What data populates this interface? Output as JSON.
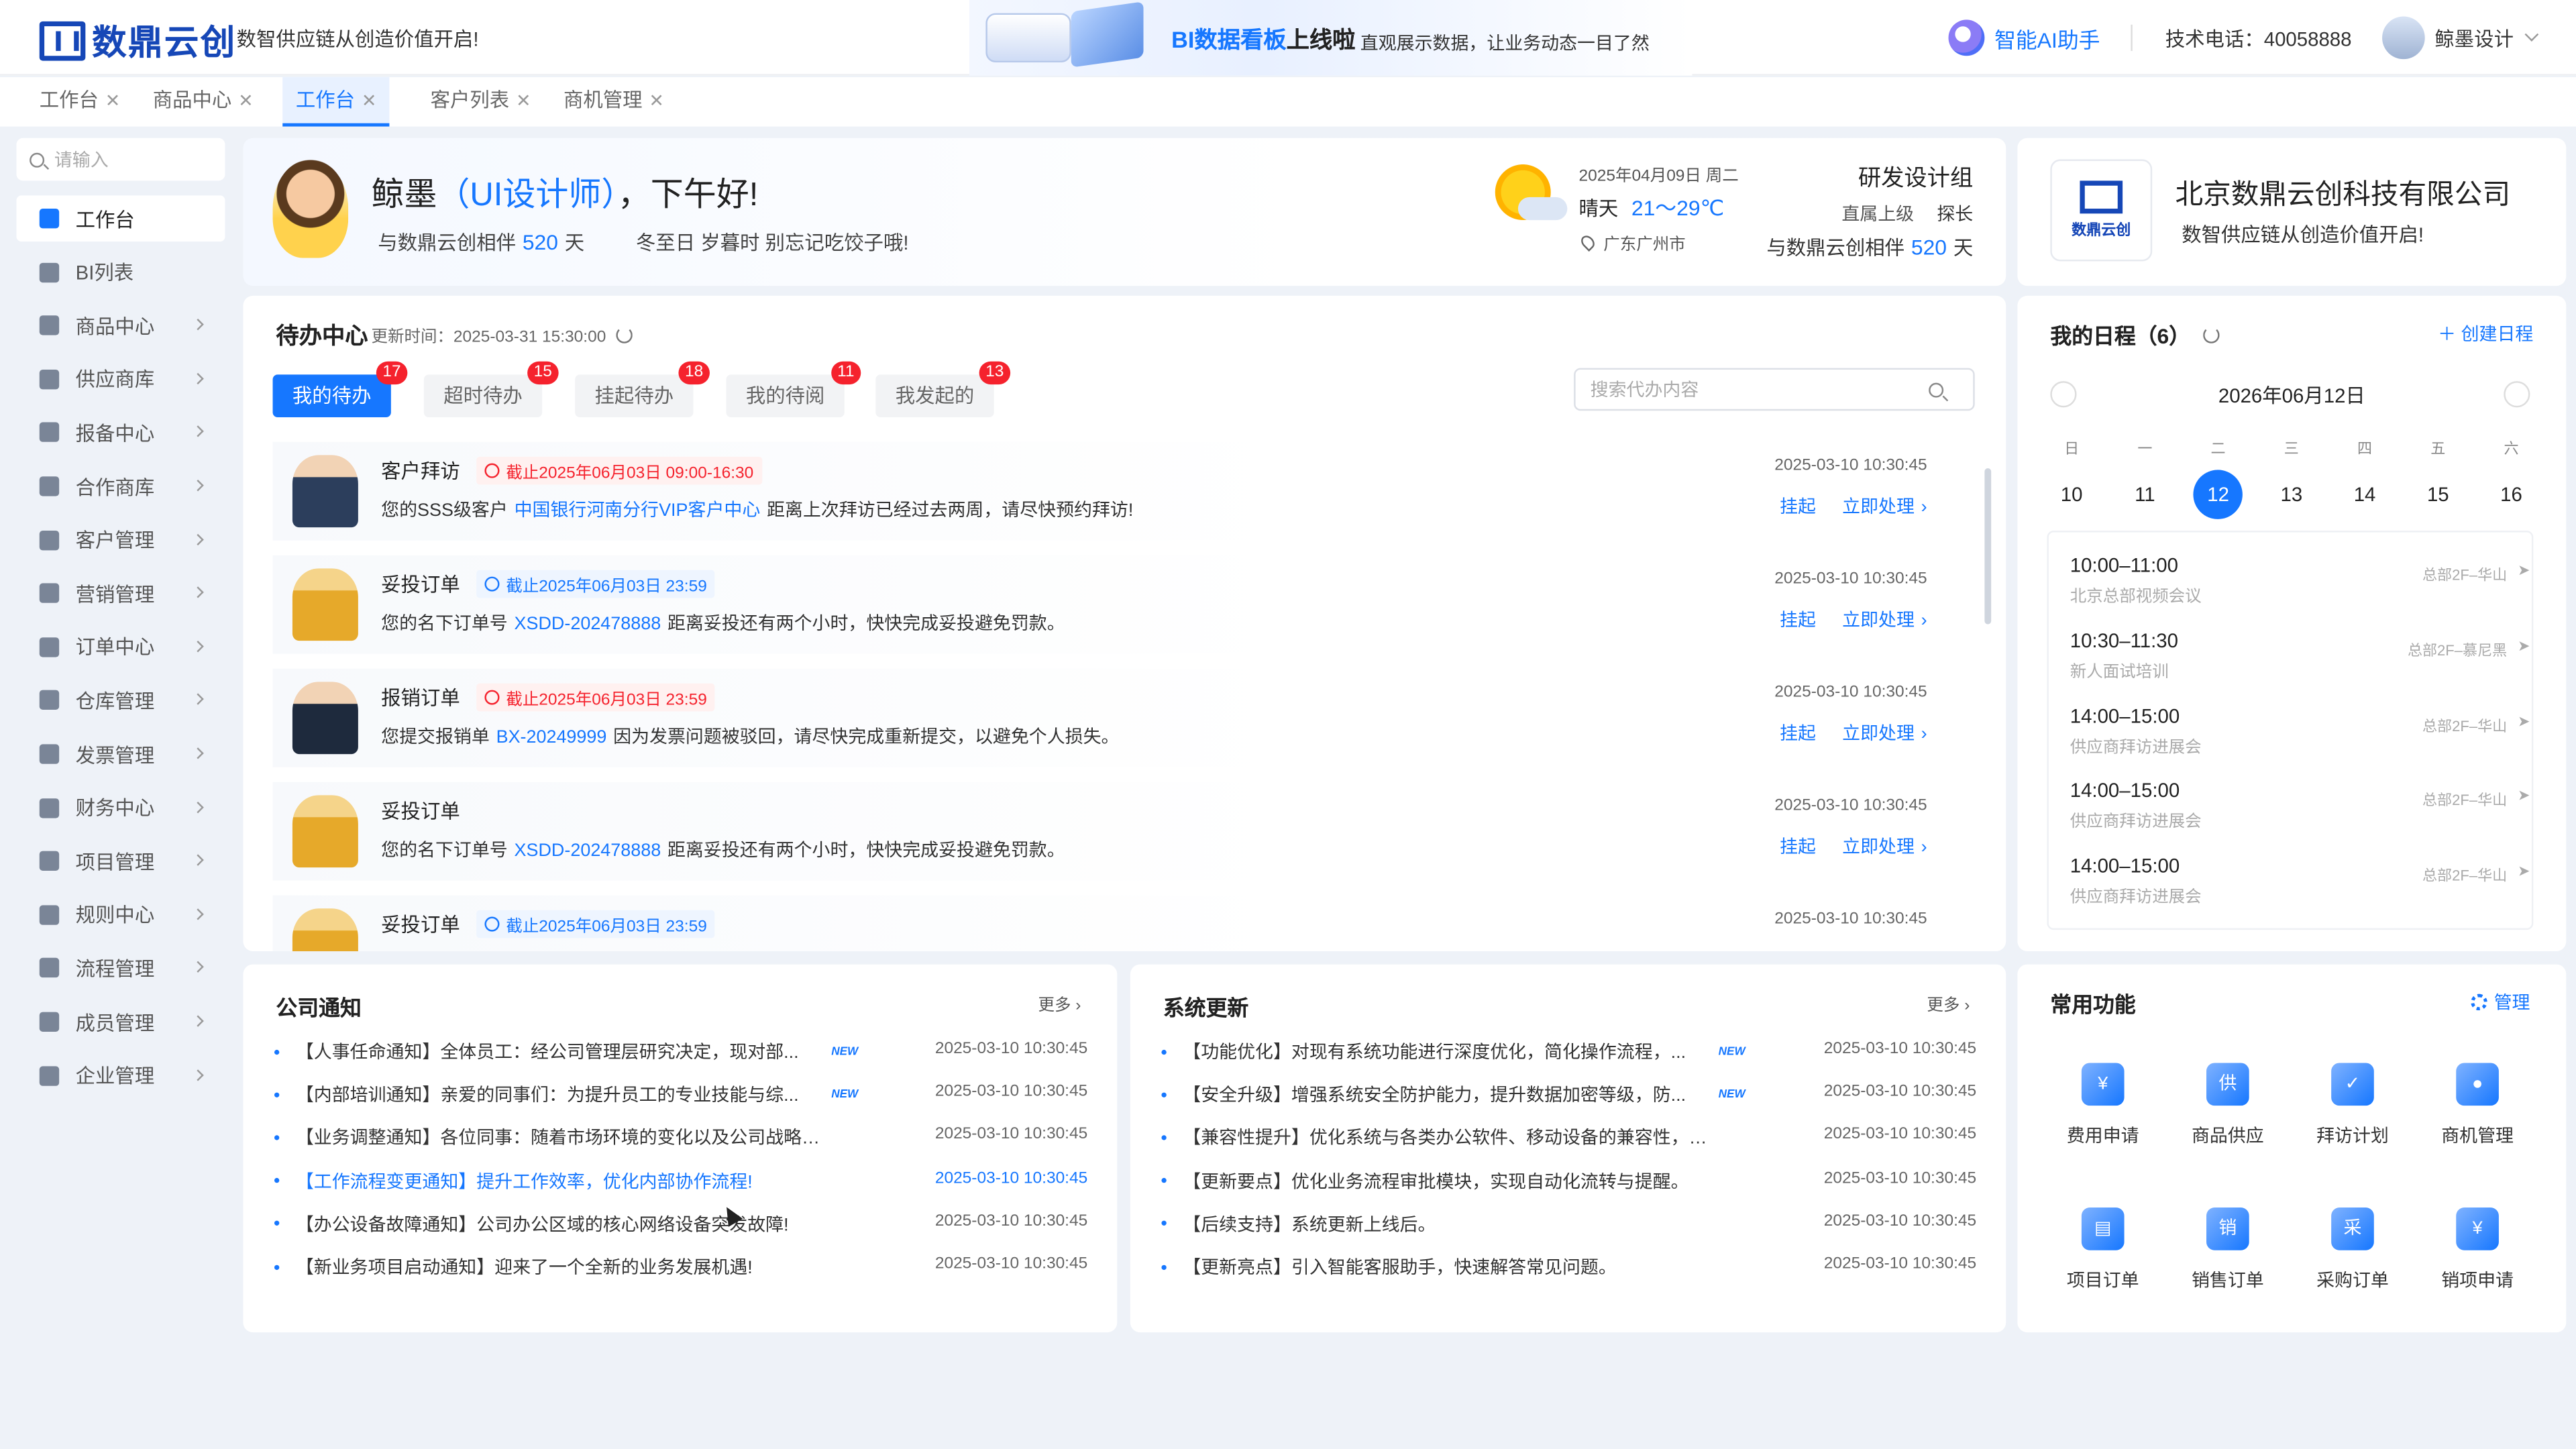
{
  "header": {
    "logo_text": "数鼎云创",
    "slogan": "数智供应链从创造价值开启!",
    "banner_title_a": "BI数据看板",
    "banner_title_b": "上线啦",
    "banner_sub": "直观展示数据，让业务动态一目了然",
    "ai_label": "智能AI助手",
    "tel": "技术电话：40058888",
    "user": "鲸墨设计"
  },
  "tabs": [
    "工作台",
    "商品中心",
    "工作台",
    "客户列表",
    "商机管理"
  ],
  "sidebar": {
    "search_placeholder": "请输入",
    "items": [
      "工作台",
      "BI列表",
      "商品中心",
      "供应商库",
      "报备中心",
      "合作商库",
      "客户管理",
      "营销管理",
      "订单中心",
      "仓库管理",
      "发票管理",
      "财务中心",
      "项目管理",
      "规则中心",
      "流程管理",
      "成员管理",
      "企业管理"
    ]
  },
  "greeting": {
    "name": "鲸墨",
    "role": "（UI设计师）",
    "tail": "，下午好!",
    "sub_a": "与数鼎云创相伴",
    "sub_days": "520",
    "sub_b": "天",
    "note": "冬至日  岁暮时  别忘记吃饺子哦!",
    "date": "2025年04月09日 周二",
    "weather": "晴天",
    "temp": "21～29℃",
    "location": "广东广州市",
    "dept": "研发设计组",
    "sup_label": "直属上级",
    "sup_name": "探长",
    "days_a": "与数鼎云创相伴",
    "days_num": "520",
    "days_b": "天"
  },
  "company": {
    "name": "北京数鼎云创科技有限公司",
    "slogan": "数智供应链从创造价值开启!",
    "logo_text": "数鼎云创"
  },
  "todo": {
    "title": "待办中心",
    "updated": "更新时间：2025-03-31 15:30:00",
    "search_placeholder": "搜索代办内容",
    "tabs": [
      {
        "label": "我的待办",
        "badge": "17"
      },
      {
        "label": "超时待办",
        "badge": "15"
      },
      {
        "label": "挂起待办",
        "badge": "18"
      },
      {
        "label": "我的待阅",
        "badge": "11"
      },
      {
        "label": "我发起的",
        "badge": "13"
      }
    ],
    "hang": "挂起",
    "process": "立即处理",
    "items": [
      {
        "title": "客户拜访",
        "deadline": "截止2025年06月03日 09:00-16:30",
        "pre": "您的SSS级客户",
        "link": "中国银行河南分行VIP客户中心",
        "post": "距离上次拜访已经过去两周，请尽快预约拜访!",
        "time": "2025-03-10 10:30:45"
      },
      {
        "title": "妥投订单",
        "deadline": "截止2025年06月03日 23:59",
        "pre": "您的名下订单号",
        "link": "XSDD-202478888",
        "post": "距离妥投还有两个小时，快快完成妥投避免罚款。",
        "time": "2025-03-10 10:30:45"
      },
      {
        "title": "报销订单",
        "deadline": "截止2025年06月03日 23:59",
        "pre": "您提交报销单",
        "link": "BX-20249999",
        "post": "因为发票问题被驳回，请尽快完成重新提交，以避免个人损失。",
        "time": "2025-03-10 10:30:45"
      },
      {
        "title": "妥投订单",
        "deadline": "",
        "pre": "您的名下订单号",
        "link": "XSDD-202478888",
        "post": "距离妥投还有两个小时，快快完成妥投避免罚款。",
        "time": "2025-03-10 10:30:45"
      },
      {
        "title": "妥投订单",
        "deadline": "截止2025年06月03日 23:59",
        "pre": "",
        "link": "",
        "post": "",
        "time": "2025-03-10 10:30:45"
      }
    ]
  },
  "schedule": {
    "title": "我的日程（6）",
    "create": "创建日程",
    "month": "2026年06月12日",
    "weekdays": [
      "日",
      "一",
      "二",
      "三",
      "四",
      "五",
      "六"
    ],
    "days": [
      "10",
      "11",
      "12",
      "13",
      "14",
      "15",
      "16"
    ],
    "events": [
      {
        "time": "10:00–11:00",
        "name": "北京总部视频会议",
        "place": "总部2F–华山"
      },
      {
        "time": "10:30–11:30",
        "name": "新人面试培训",
        "place": "总部2F–慕尼黑"
      },
      {
        "time": "14:00–15:00",
        "name": "供应商拜访进展会",
        "place": "总部2F–华山"
      },
      {
        "time": "14:00–15:00",
        "name": "供应商拜访进展会",
        "place": "总部2F–华山"
      },
      {
        "time": "14:00–15:00",
        "name": "供应商拜访进展会",
        "place": "总部2F–华山"
      }
    ]
  },
  "notices": {
    "title": "公司通知",
    "more": "更多",
    "items": [
      {
        "text": "【人事任命通知】全体员工：经公司管理层研究决定，现对部...",
        "new": "NEW",
        "time": "2025-03-10 10:30:45"
      },
      {
        "text": "【内部培训通知】亲爱的同事们：为提升员工的专业技能与综...",
        "new": "NEW",
        "time": "2025-03-10 10:30:45"
      },
      {
        "text": "【业务调整通知】各位同事：随着市场环境的变化以及公司战略布...",
        "new": "",
        "time": "2025-03-10 10:30:45"
      },
      {
        "text": "【工作流程变更通知】提升工作效率，优化内部协作流程!",
        "new": "",
        "time": "2025-03-10 10:30:45"
      },
      {
        "text": "【办公设备故障通知】公司办公区域的核心网络设备突发故障!",
        "new": "",
        "time": "2025-03-10 10:30:45"
      },
      {
        "text": "【新业务项目启动通知】迎来了一个全新的业务发展机遇!",
        "new": "",
        "time": "2025-03-10 10:30:45"
      }
    ]
  },
  "updates": {
    "title": "系统更新",
    "more": "更多",
    "items": [
      {
        "text": "【功能优化】对现有系统功能进行深度优化，简化操作流程，...",
        "new": "NEW",
        "time": "2025-03-10 10:30:45"
      },
      {
        "text": "【安全升级】增强系统安全防护能力，提升数据加密等级，防...",
        "new": "NEW",
        "time": "2025-03-10 10:30:45"
      },
      {
        "text": "【兼容性提升】优化系统与各类办公软件、移动设备的兼容性，便...",
        "new": "",
        "time": "2025-03-10 10:30:45"
      },
      {
        "text": "【更新要点】优化业务流程审批模块，实现自动化流转与提醒。",
        "new": "",
        "time": "2025-03-10 10:30:45"
      },
      {
        "text": "【后续支持】系统更新上线后。",
        "new": "",
        "time": "2025-03-10 10:30:45"
      },
      {
        "text": "【更新亮点】引入智能客服助手，快速解答常见问题。",
        "new": "",
        "time": "2025-03-10 10:30:45"
      }
    ]
  },
  "functions": {
    "title": "常用功能",
    "manage": "管理",
    "items": [
      {
        "label": "费用申请",
        "glyph": "¥"
      },
      {
        "label": "商品供应",
        "glyph": "供"
      },
      {
        "label": "拜访计划",
        "glyph": "✓"
      },
      {
        "label": "商机管理",
        "glyph": "●"
      },
      {
        "label": "项目订单",
        "glyph": "▤"
      },
      {
        "label": "销售订单",
        "glyph": "销"
      },
      {
        "label": "采购订单",
        "glyph": "采"
      },
      {
        "label": "销项申请",
        "glyph": "¥"
      }
    ]
  }
}
